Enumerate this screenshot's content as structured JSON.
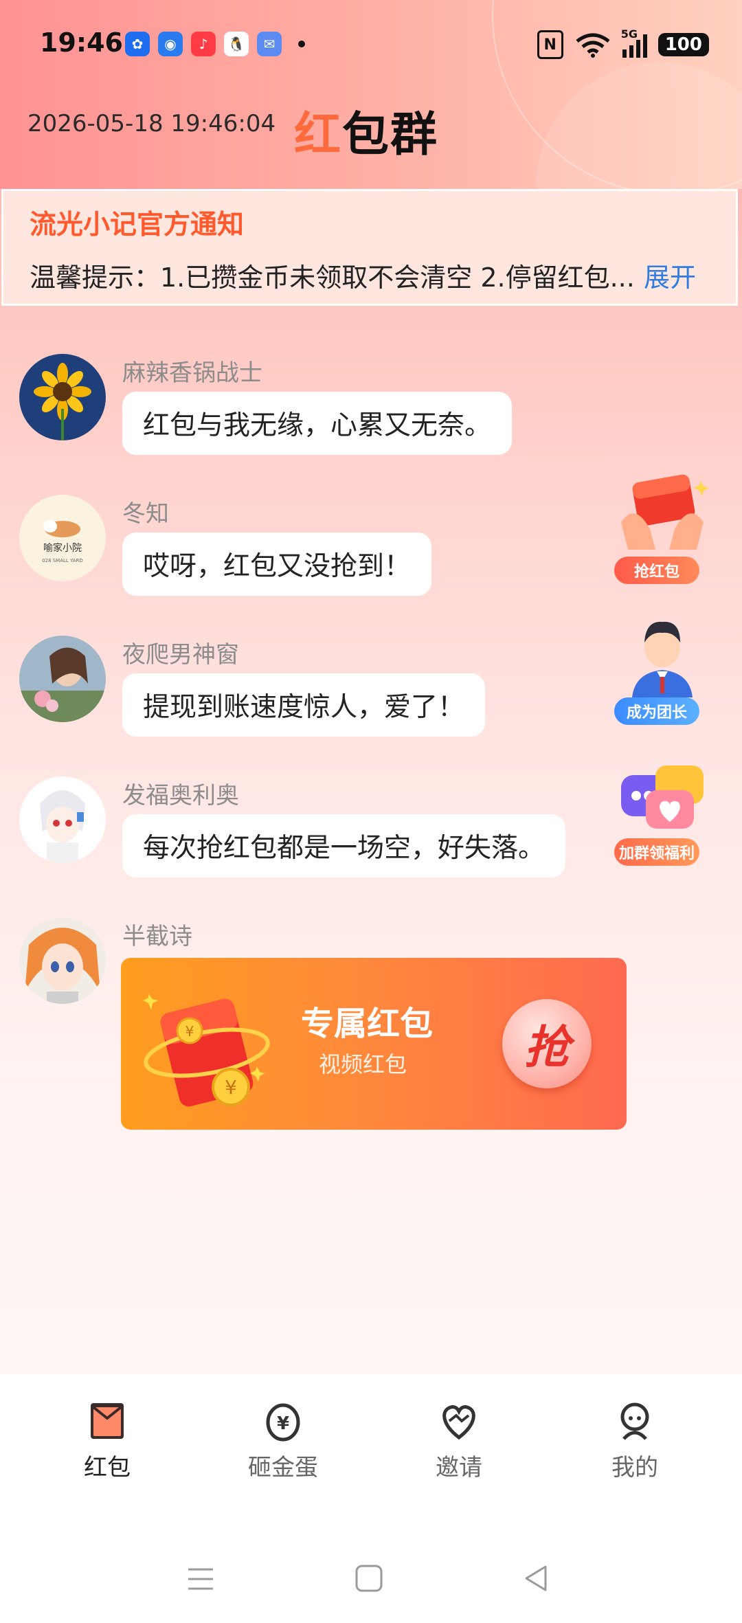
{
  "status_bar": {
    "time": "19:46",
    "battery": "100",
    "network": "5G"
  },
  "header": {
    "datetime": "2026-05-18 19:46:04",
    "title_first": "红",
    "title_rest": "包群"
  },
  "notice": {
    "title": "流光小记官方通知",
    "body": "温馨提示：1.已攒金币未领取不会清空 2.停留红包...",
    "expand_label": "展开"
  },
  "messages": [
    {
      "name": "麻辣香锅战士",
      "text": "红包与我无缘，心累又无奈。"
    },
    {
      "name": "冬知",
      "text": "哎呀，红包又没抢到！"
    },
    {
      "name": "夜爬男神窗",
      "text": "提现到账速度惊人，爱了！"
    },
    {
      "name": "发福奥利奥",
      "text": "每次抢红包都是一场空，好失落。"
    },
    {
      "name": "半截诗"
    }
  ],
  "red_packet": {
    "title": "专属红包",
    "subtitle": "视频红包",
    "grab_label": "抢"
  },
  "side_actions": [
    {
      "label": "抢红包"
    },
    {
      "label": "成为团长"
    },
    {
      "label": "加群领福利"
    }
  ],
  "bottom_nav": [
    {
      "label": "红包",
      "active": true
    },
    {
      "label": "砸金蛋"
    },
    {
      "label": "邀请"
    },
    {
      "label": "我的"
    }
  ],
  "avatar_text": {
    "dongzhi_line1": "喻家小院",
    "dongzhi_line2": "028 SMALL YARD"
  },
  "colors": {
    "accent": "#ff5a2d",
    "link": "#2f7de1"
  }
}
